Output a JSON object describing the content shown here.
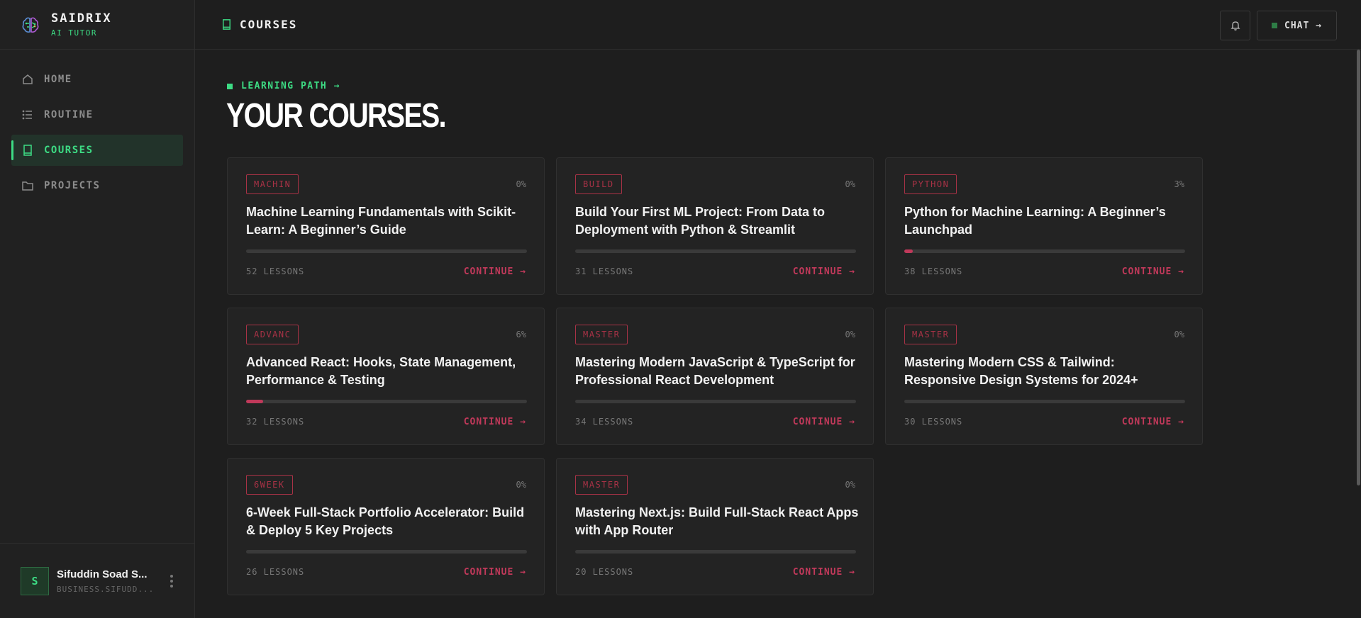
{
  "brand": {
    "name": "SAIDRIX",
    "subtitle": "AI TUTOR"
  },
  "nav": [
    {
      "label": "HOME",
      "icon": "home-icon",
      "active": false
    },
    {
      "label": "ROUTINE",
      "icon": "list-icon",
      "active": false
    },
    {
      "label": "COURSES",
      "icon": "book-icon",
      "active": true
    },
    {
      "label": "PROJECTS",
      "icon": "folder-icon",
      "active": false
    }
  ],
  "user": {
    "initial": "S",
    "name": "Sifuddin Soad S...",
    "email": "BUSINESS.SIFUDD..."
  },
  "topbar": {
    "title": "COURSES",
    "chat_label": "CHAT →"
  },
  "main": {
    "eyebrow": "LEARNING PATH →",
    "title": "YOUR COURSES."
  },
  "colors": {
    "accent_green": "#3ddc84",
    "accent_red": "#c0395a",
    "background": "#1e1e1e"
  },
  "courses": [
    {
      "tag": "MACHIN",
      "percent": "0%",
      "progress": 0,
      "title": "Machine Learning Fundamentals with Scikit-Learn: A Beginner’s Guide",
      "lessons": "52 LESSONS",
      "cta": "CONTINUE →"
    },
    {
      "tag": "BUILD",
      "percent": "0%",
      "progress": 0,
      "title": "Build Your First ML Project: From Data to Deployment with Python & Streamlit",
      "lessons": "31 LESSONS",
      "cta": "CONTINUE →"
    },
    {
      "tag": "PYTHON",
      "percent": "3%",
      "progress": 3,
      "title": "Python for Machine Learning: A Beginner’s Launchpad",
      "lessons": "38 LESSONS",
      "cta": "CONTINUE →"
    },
    {
      "tag": "ADVANC",
      "percent": "6%",
      "progress": 6,
      "title": "Advanced React: Hooks, State Management, Performance & Testing",
      "lessons": "32 LESSONS",
      "cta": "CONTINUE →"
    },
    {
      "tag": "MASTER",
      "percent": "0%",
      "progress": 0,
      "title": "Mastering Modern JavaScript & TypeScript for Professional React Development",
      "lessons": "34 LESSONS",
      "cta": "CONTINUE →"
    },
    {
      "tag": "MASTER",
      "percent": "0%",
      "progress": 0,
      "title": "Mastering Modern CSS & Tailwind: Responsive Design Systems for 2024+",
      "lessons": "30 LESSONS",
      "cta": "CONTINUE →"
    },
    {
      "tag": "6WEEK",
      "percent": "0%",
      "progress": 0,
      "title": "6-Week Full-Stack Portfolio Accelerator: Build & Deploy 5 Key Projects",
      "lessons": "26 LESSONS",
      "cta": "CONTINUE →"
    },
    {
      "tag": "MASTER",
      "percent": "0%",
      "progress": 0,
      "title": "Mastering Next.js: Build Full-Stack React Apps with App Router",
      "lessons": "20 LESSONS",
      "cta": "CONTINUE →"
    }
  ]
}
